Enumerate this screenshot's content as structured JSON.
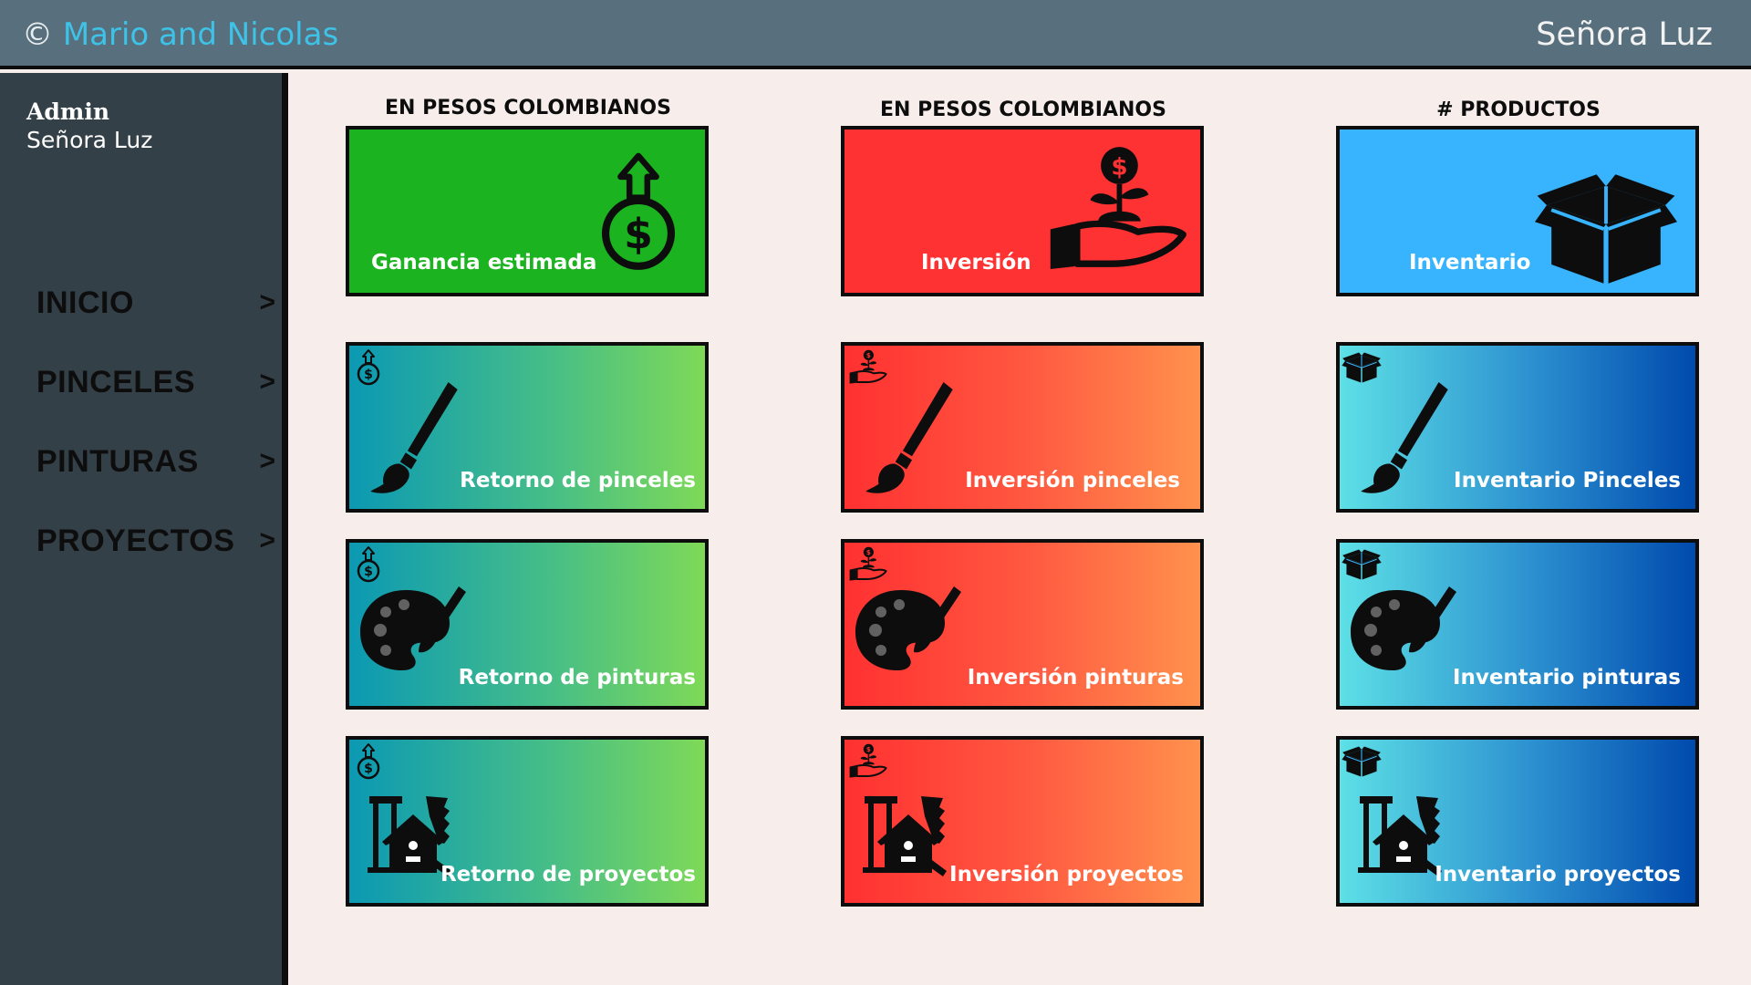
{
  "header": {
    "copyright_symbol": "©",
    "brand": "Mario and Nicolas",
    "user": "Señora Luz"
  },
  "sidebar": {
    "role": "Admin",
    "user": "Señora Luz",
    "items": [
      {
        "label": "INICIO",
        "arrow": ">"
      },
      {
        "label": "PINCELES",
        "arrow": ">"
      },
      {
        "label": "PINTURAS",
        "arrow": ">"
      },
      {
        "label": "PROYECTOS",
        "arrow": ">"
      }
    ]
  },
  "columns": [
    {
      "header": "EN PESOS COLOMBIANOS"
    },
    {
      "header": "EN PESOS COLOMBIANOS"
    },
    {
      "header": "# PRODUCTOS"
    }
  ],
  "cards": {
    "summary": [
      {
        "label": "Ganancia estimada",
        "icon": "money-bag-up-icon"
      },
      {
        "label": "Inversión",
        "icon": "hand-coin-plant-icon"
      },
      {
        "label": "Inventario",
        "icon": "box-icon"
      }
    ],
    "pinceles": [
      {
        "label": "Retorno de pinceles",
        "icon": "paintbrush-icon"
      },
      {
        "label": "Inversión pinceles",
        "icon": "paintbrush-icon"
      },
      {
        "label": "Inventario Pinceles",
        "icon": "paintbrush-icon"
      }
    ],
    "pinturas": [
      {
        "label": "Retorno de pinturas",
        "icon": "palette-icon"
      },
      {
        "label": "Inversión  pinturas",
        "icon": "palette-icon"
      },
      {
        "label": "Inventario pinturas",
        "icon": "palette-icon"
      }
    ],
    "proyectos": [
      {
        "label": "Retorno de proyectos",
        "icon": "birdhouse-tools-icon"
      },
      {
        "label": "Inversión proyectos",
        "icon": "birdhouse-tools-icon"
      },
      {
        "label": "Inventario proyectos",
        "icon": "birdhouse-tools-icon"
      }
    ]
  },
  "colors": {
    "topbar": "#58707d",
    "sidebar": "#344047",
    "content_bg": "#f7eeec",
    "brand_accent": "#3fc2e8",
    "green": "#1bb31f",
    "red": "#fe3233",
    "blue": "#38b4fe"
  }
}
